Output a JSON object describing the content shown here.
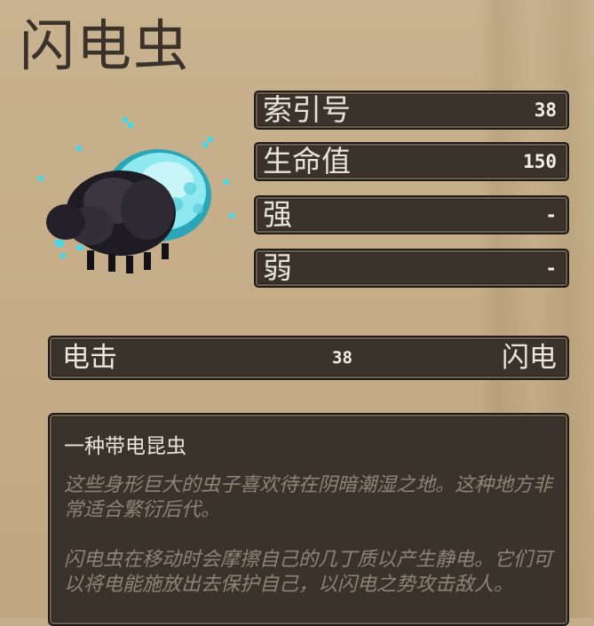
{
  "enemy": {
    "name": "闪电虫",
    "portrait_icon": "lightning-bug-icon"
  },
  "stats": [
    {
      "label": "索引号",
      "value": "38"
    },
    {
      "label": "生命值",
      "value": "150"
    },
    {
      "label": "强",
      "value": "-"
    },
    {
      "label": "弱",
      "value": "-"
    }
  ],
  "attack": {
    "name": "电击",
    "damage": "38",
    "element": "闪电"
  },
  "description": {
    "heading": "一种带电昆虫",
    "paragraph1": "这些身形巨大的虫子喜欢待在阴暗潮湿之地。这种地方非常适合繁衍后代。",
    "paragraph2": "闪电虫在移动时会摩擦自己的几丁质以产生静电。它们可以将电能施放出去保护自己，以闪电之势攻击敌人。"
  },
  "colors": {
    "parchment": "#c4ad8a",
    "panel": "#3a332c",
    "electric": "#4fd4e0"
  }
}
